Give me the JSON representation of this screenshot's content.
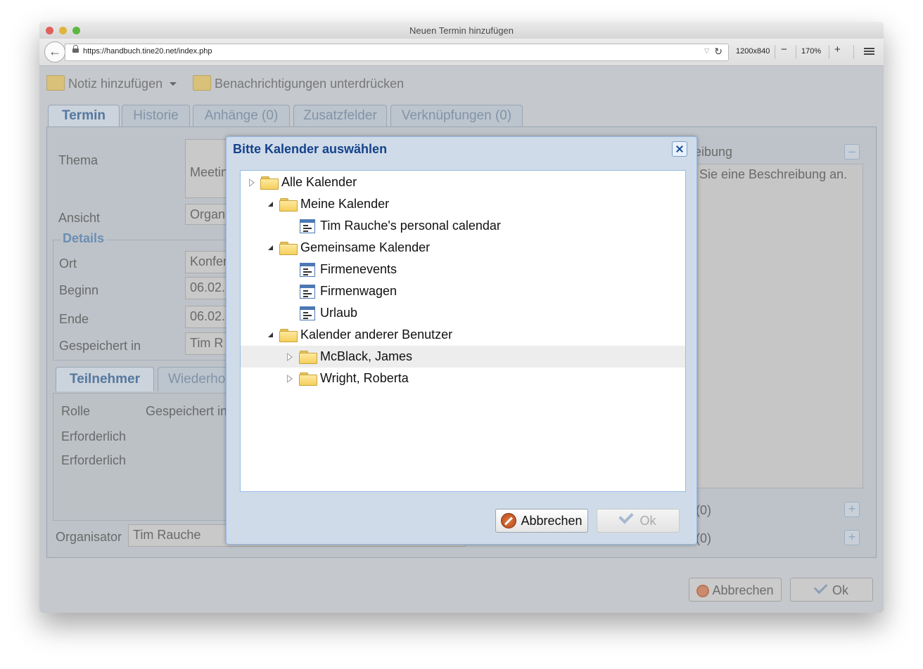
{
  "window": {
    "title": "Neuen Termin hinzufügen"
  },
  "browser": {
    "url": "https://handbuch.tine20.net/index.php",
    "viewport": "1200x840",
    "zoom": "170%",
    "zoom_out": "−",
    "zoom_in": "+"
  },
  "toolbar": {
    "add_note": "Notiz hinzufügen",
    "suppress_notifications": "Benachrichtigungen unterdrücken"
  },
  "tabs": [
    "Termin",
    "Historie",
    "Anhänge (0)",
    "Zusatzfelder",
    "Verknüpfungen (0)"
  ],
  "form": {
    "thema_label": "Thema",
    "thema_value": "Meetin",
    "ansicht_label": "Ansicht",
    "ansicht_value": "Organ",
    "details_title": "Details",
    "ort_label": "Ort",
    "ort_value": "Konfer",
    "beginn_label": "Beginn",
    "beginn_value": "06.02.",
    "ende_label": "Ende",
    "ende_value": "06.02.",
    "gespeichert_label": "Gespeichert in",
    "gespeichert_value": "Tim R",
    "description_title": "eibung",
    "description_placeholder": "Sie eine Beschreibung an.",
    "attachments_count": "(0)",
    "other_count": "(0)"
  },
  "attendees": {
    "tabs": [
      "Teilnehmer",
      "Wiederho"
    ],
    "columns": [
      "Rolle",
      "Gespeichert in"
    ],
    "rows": [
      {
        "rolle": "Erforderlich"
      },
      {
        "rolle": "Erforderlich"
      }
    ],
    "organizer_label": "Organisator",
    "organizer_value": "Tim Rauche"
  },
  "footer": {
    "cancel": "Abbrechen",
    "ok": "Ok"
  },
  "dialog": {
    "title": "Bitte Kalender auswählen",
    "cancel": "Abbrechen",
    "ok": "Ok",
    "tree": [
      {
        "label": "Alle Kalender",
        "type": "folder",
        "expander": "closed"
      },
      {
        "label": "Meine Kalender",
        "type": "folder",
        "expander": "open"
      },
      {
        "label": "Tim Rauche's personal calendar",
        "type": "calendar"
      },
      {
        "label": "Gemeinsame Kalender",
        "type": "folder",
        "expander": "open"
      },
      {
        "label": "Firmenevents",
        "type": "calendar"
      },
      {
        "label": "Firmenwagen",
        "type": "calendar"
      },
      {
        "label": "Urlaub",
        "type": "calendar"
      },
      {
        "label": "Kalender anderer Benutzer",
        "type": "folder",
        "expander": "open"
      },
      {
        "label": "McBlack, James",
        "type": "folder",
        "expander": "closed",
        "highlighted": true
      },
      {
        "label": "Wright, Roberta",
        "type": "folder",
        "expander": "closed"
      }
    ]
  },
  "colors": {
    "dialog_title": "#15428b",
    "tree_border": "#99bbe8",
    "tab_active_text": "#55789e"
  }
}
